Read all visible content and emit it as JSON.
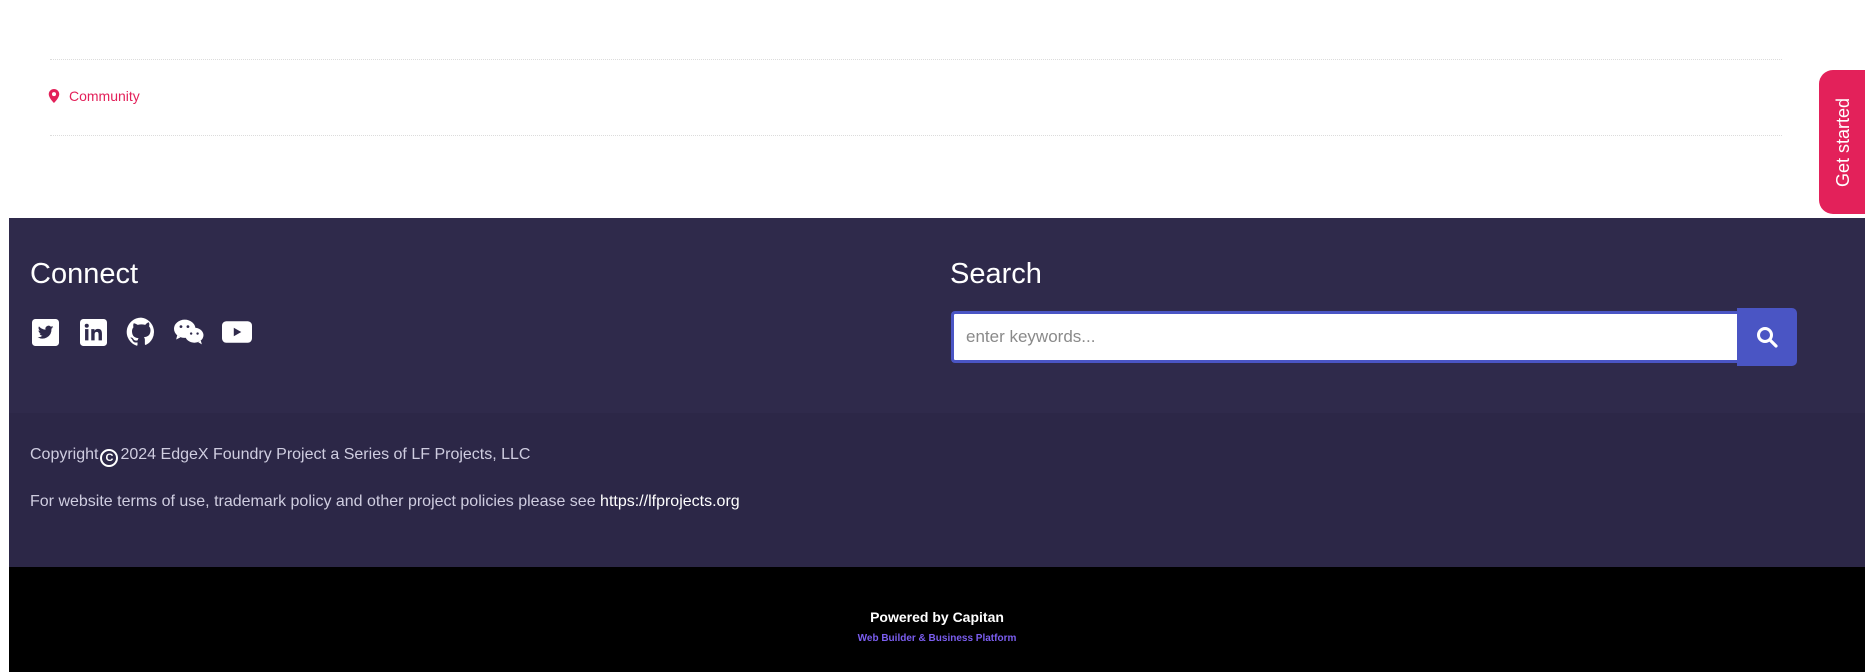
{
  "breadcrumb": {
    "label": "Community",
    "icon": "map-pin-icon"
  },
  "cta": {
    "label": "Get started",
    "color": "#e3215a"
  },
  "footer": {
    "connect_title": "Connect",
    "social": [
      "twitter-icon",
      "linkedin-icon",
      "github-icon",
      "wechat-icon",
      "youtube-icon"
    ],
    "search_title": "Search",
    "search_placeholder": "enter keywords...",
    "search_button_icon": "search-icon",
    "accent": "#4a55c4",
    "background": "#2f2a4b"
  },
  "legal": {
    "copyright_prefix": "Copyright",
    "copyright_symbol": "C",
    "copyright_text": "2024 EdgeX Foundry Project a Series of LF Projects, LLC",
    "terms_text": "For website terms of use, trademark policy and other project policies please see ",
    "terms_link": "https://lfprojects.org"
  },
  "powered": {
    "line1": "Powered by Capitan",
    "line2": "Web Builder & Business Platform"
  }
}
